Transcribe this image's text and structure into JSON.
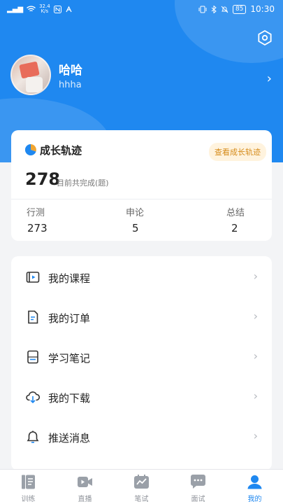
{
  "status_bar": {
    "signal": "▂▄▆",
    "speed": "32.4\nK/s",
    "battery": "85",
    "time": "10:30"
  },
  "profile": {
    "name": "哈哈",
    "id": "hhha"
  },
  "growth": {
    "title": "成长轨迹",
    "link_label": "查看成长轨迹",
    "total": "278",
    "total_label": "目前共完成(题)",
    "stats": [
      {
        "label": "行测",
        "value": "273"
      },
      {
        "label": "申论",
        "value": "5"
      },
      {
        "label": "总结",
        "value": "2"
      }
    ]
  },
  "menu": [
    {
      "label": "我的课程",
      "icon": "course-icon"
    },
    {
      "label": "我的订单",
      "icon": "order-icon"
    },
    {
      "label": "学习笔记",
      "icon": "notes-icon"
    },
    {
      "label": "我的下载",
      "icon": "download-icon"
    },
    {
      "label": "推送消息",
      "icon": "bell-icon"
    }
  ],
  "tabs": [
    {
      "label": "训练",
      "icon": "training-icon"
    },
    {
      "label": "直播",
      "icon": "live-icon"
    },
    {
      "label": "笔试",
      "icon": "written-exam-icon"
    },
    {
      "label": "面试",
      "icon": "interview-icon"
    },
    {
      "label": "我的",
      "icon": "profile-icon",
      "active": true
    }
  ],
  "colors": {
    "primary": "#1f88f0",
    "accent_orange": "#d58b1a",
    "inactive": "#8f939a"
  }
}
